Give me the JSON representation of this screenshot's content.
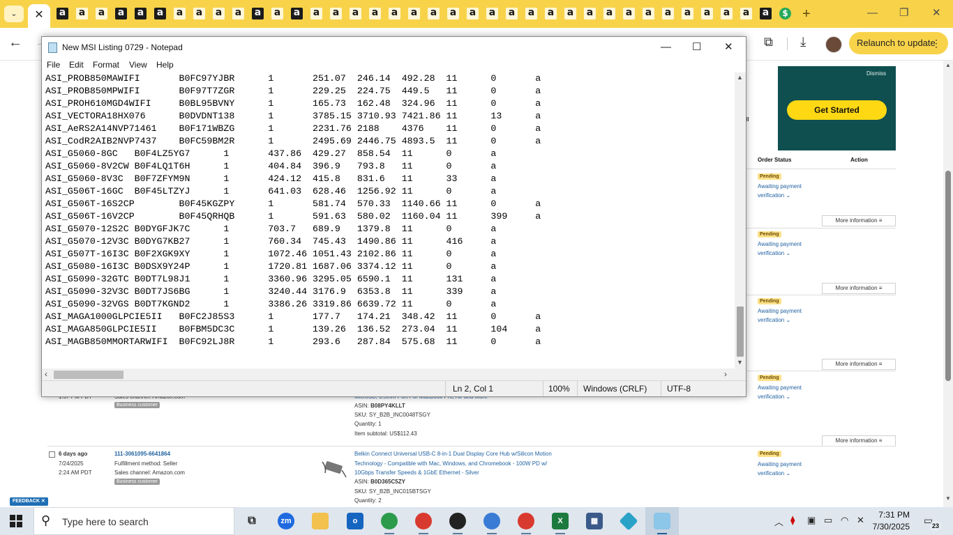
{
  "browser": {
    "tab_menu_icon": "⌄",
    "active_tab_close": "✕",
    "tab_favicon_letter": "a",
    "new_tab_symbol": "+",
    "minimize_symbol": "—",
    "restore_symbol": "❐",
    "close_symbol": "✕",
    "back_symbol": "←",
    "forward_symbol": "→",
    "extensions_icon": "⧉",
    "download_icon": "⤓",
    "relaunch_label": "Relaunch to update",
    "relaunch_menu": "⋮",
    "colors": {
      "tabbar": "#f8d34a",
      "relaunch": "#f8d34a"
    }
  },
  "page": {
    "ad": {
      "dismiss": "Dismiss",
      "cta": "Get Started"
    },
    "header": {
      "order_status": "Order Status",
      "action": "Action"
    },
    "partial_text": "ll",
    "status_pending": "Pending",
    "awaiting_1": "Awaiting payment",
    "awaiting_2": "verification",
    "more_info": "More information",
    "prev_order": {
      "time": "1:37 PM PDT",
      "sales_channel": "Sales channel: Amazon.com",
      "badge": "Business customer",
      "product_fragment": "MicroSD, 3.5mm Port For MacBook Pro, Air and More",
      "asin_label": "ASIN:",
      "asin": "B08PY4KLLT",
      "sku": "SKU: SY_B2B_INC0048TSGY",
      "quantity": "Quantity: 1",
      "subtotal": "Item subtotal: US$112.43"
    },
    "order": {
      "age": "6 days ago",
      "date": "7/24/2025",
      "time": "2:24 AM PDT",
      "order_id": "111-3061095-6641864",
      "fulfillment": "Fulfillment method: Seller",
      "sales_channel": "Sales channel: Amazon.com",
      "badge": "Business customer",
      "product_line1": "Belkin Connect Universal USB-C 8-in-1 Dual Display Core Hub w/Silicon Motion",
      "product_line2": "Technology - Compatible with Mac, Windows, and Chromebook - 100W PD w/",
      "product_line3": "10Gbps Transfer Speeds & 1GbE Ethernet - Silver",
      "asin_label": "ASIN:",
      "asin": "B0D365C5ZY",
      "sku": "SKU: SY_B2B_INC015BTSGY",
      "quantity": "Quantity: 2"
    },
    "feedback": "FEEDBACK ✕"
  },
  "notepad": {
    "title": "New  MSI Listing 0729 - Notepad",
    "min_symbol": "—",
    "max_symbol": "☐",
    "close_symbol": "✕",
    "menu": {
      "file": "File",
      "edit": "Edit",
      "format": "Format",
      "view": "View",
      "help": "Help"
    },
    "content": "ASI_PROB850MAWIFI\tB0FC97YJBR\t1\t251.07\t246.14\t492.28\t11\t0\ta\nASI_PROB850MPWIFI\tB0F97T7ZGR\t1\t229.25\t224.75\t449.5\t11\t0\ta\nASI_PROH610MGD4WIFI\tB0BL95BVNY\t1\t165.73\t162.48\t324.96\t11\t0\ta\nASI_VECTORA18HX076\tB0DVDNT138\t1\t3785.15\t3710.93\t7421.86\t11\t13\ta\nASI_AeRS2A14NVP71461\tB0F171WBZG\t1\t2231.76\t2188\t4376\t11\t0\ta\nASI_CodR2AIB2NVP7437\tB0FC59BM2R\t1\t2495.69\t2446.75\t4893.5\t11\t0\ta\nASI_G5060-8GC\tB0F4LZ5YG7\t1\t437.86\t429.27\t858.54\t11\t0\ta\nASI_G5060-8V2CW\tB0F4LQ1T6H\t1\t404.84\t396.9\t793.8\t11\t0\ta\nASI_G5060-8V3C\tB0F7ZFYM9N\t1\t424.12\t415.8\t831.6\t11\t33\ta\nASI_G506T-16GC\tB0F45LTZYJ\t1\t641.03\t628.46\t1256.92\t11\t0\ta\nASI_G506T-16S2CP\tB0F45KGZPY\t1\t581.74\t570.33\t1140.66\t11\t0\ta\nASI_G506T-16V2CP\tB0F45QRHQB\t1\t591.63\t580.02\t1160.04\t11\t399\ta\nASI_G5070-12S2C\tB0DYGFJK7C\t1\t703.7\t689.9\t1379.8\t11\t0\ta\nASI_G5070-12V3C\tB0DYG7KB27\t1\t760.34\t745.43\t1490.86\t11\t416\ta\nASI_G507T-16I3C\tB0F2XGK9XY\t1\t1072.46\t1051.43\t2102.86\t11\t0\ta\nASI_G5080-16I3C\tB0DSX9Y24P\t1\t1720.81\t1687.06\t3374.12\t11\t0\ta\nASI_G5090-32GTC\tB0DT7L98J1\t1\t3360.96\t3295.05\t6590.1\t11\t131\ta\nASI_G5090-32V3C\tB0DT7JS6BG\t1\t3240.44\t3176.9\t6353.8\t11\t339\ta\nASI_G5090-32VGS\tB0DT7KGND2\t1\t3386.26\t3319.86\t6639.72\t11\t0\ta\nASI_MAGA1000GLPCIE5II\tB0FC2J85S3\t1\t177.7\t174.21\t348.42\t11\t0\ta\nASI_MAGA850GLPCIE5II\tB0FBM5DC3C\t1\t139.26\t136.52\t273.04\t11\t104\ta\nASI_MAGB850MMORTARWIFI\tB0FC92LJ8R\t1\t293.6\t287.84\t575.68\t11\t0\ta",
    "status": {
      "position": "Ln 2, Col 1",
      "zoom": "100%",
      "line_ending": "Windows (CRLF)",
      "encoding": "UTF-8"
    }
  },
  "taskbar": {
    "search_placeholder": "Type here to search",
    "search_icon": "⚲",
    "apps": [
      "Task View",
      "Zoom",
      "File Explorer",
      "Outlook",
      "Chrome",
      "Chrome",
      "Chrome",
      "Chrome",
      "Chrome",
      "Excel",
      "Calculator",
      "Kodi",
      "Notepad"
    ],
    "zoom_label": "zm",
    "excel_label": "X",
    "clock_time": "7:31 PM",
    "clock_date": "7/30/2025",
    "notification_count": "23"
  }
}
